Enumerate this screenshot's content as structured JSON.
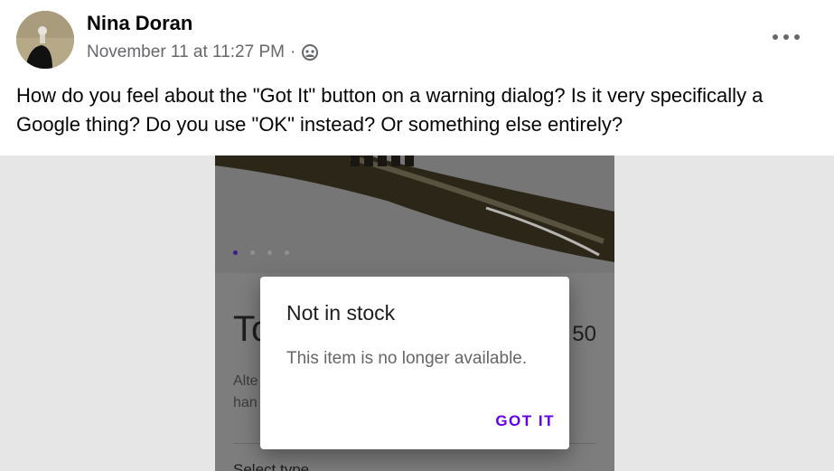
{
  "post": {
    "author": "Nina Doran",
    "timestamp": "November 11 at 11:27 PM",
    "separator": "·",
    "audience_icon": "friends-icon",
    "more_icon": "more-options-icon",
    "text": "How do you feel about the \"Got It\" button on a warning dialog? Is it very specifically a Google thing? Do you use \"OK\" instead? Or something else entirely?"
  },
  "screenshot": {
    "carousel_dots": 4,
    "carousel_active_index": 0,
    "behind_title": "To",
    "behind_price": "50",
    "behind_desc_line1": "Alte",
    "behind_desc_line2": "han",
    "behind_select": "Select type",
    "dialog": {
      "title": "Not in stock",
      "body": "This item is no longer available.",
      "button": "GOT IT"
    },
    "accent_color": "#6200ee"
  }
}
